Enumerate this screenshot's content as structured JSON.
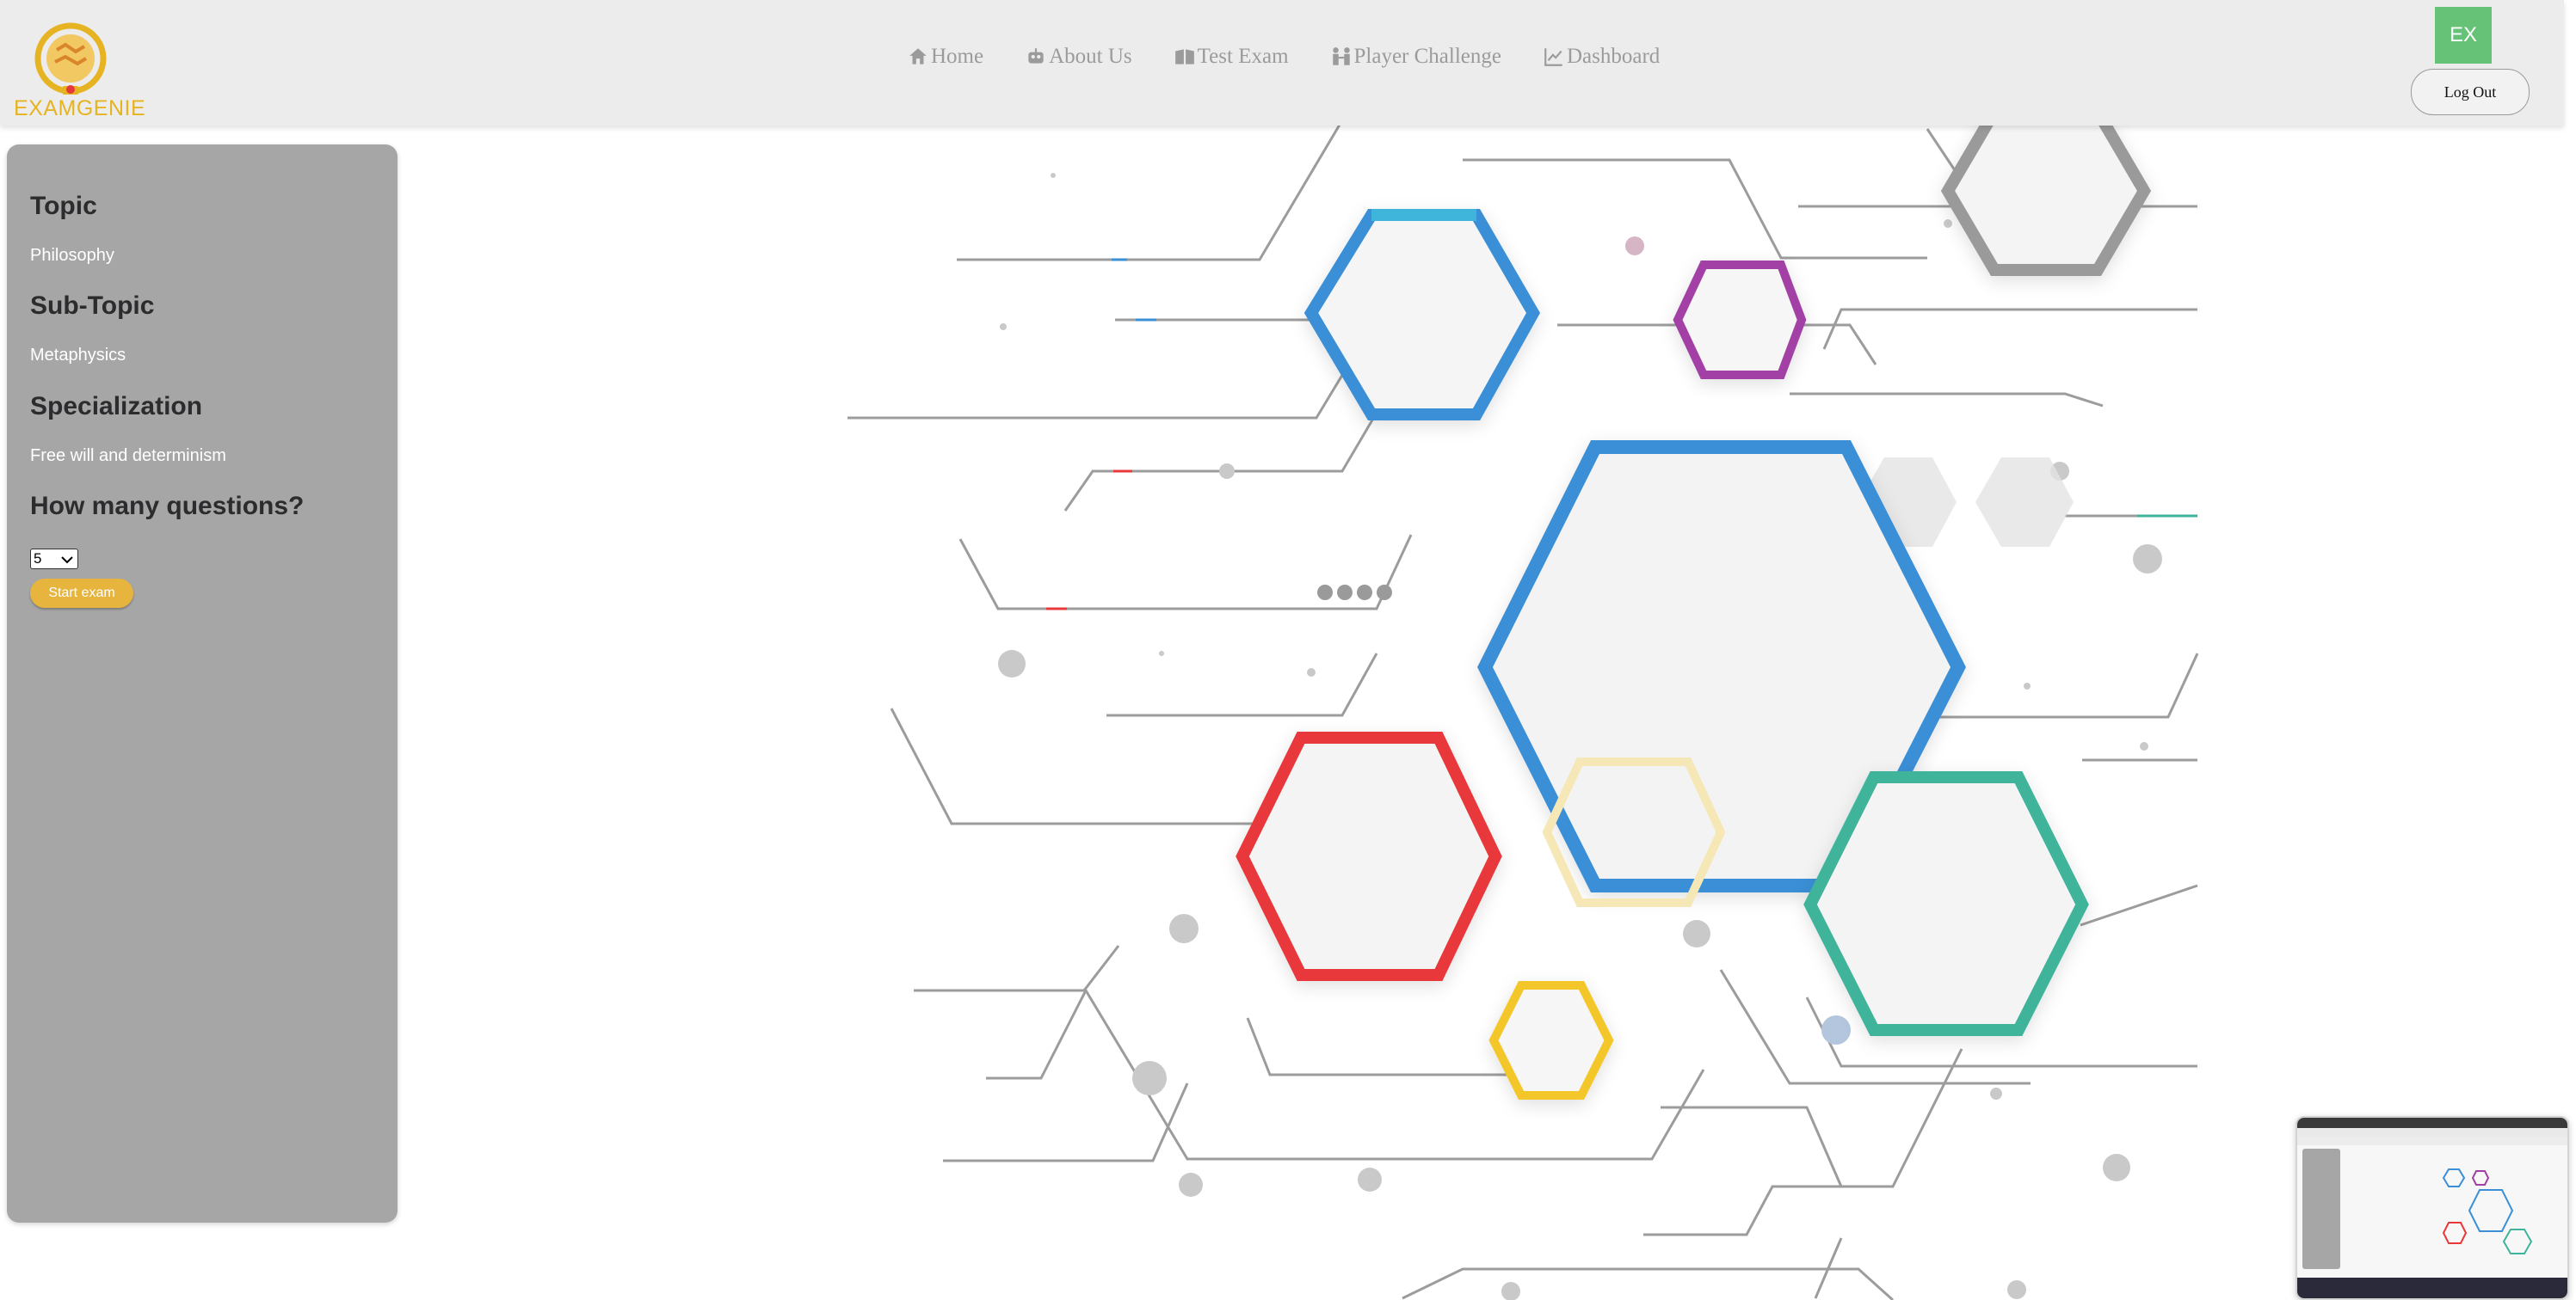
{
  "brand": {
    "name": "EXAMGENIE",
    "color": "#e6b422"
  },
  "nav": [
    {
      "label": "Home",
      "icon": "home-icon"
    },
    {
      "label": "About Us",
      "icon": "robot-icon"
    },
    {
      "label": "Test Exam",
      "icon": "book-icon"
    },
    {
      "label": "Player Challenge",
      "icon": "players-icon"
    },
    {
      "label": "Dashboard",
      "icon": "chart-icon"
    }
  ],
  "user": {
    "initials": "EX",
    "logout_label": "Log Out",
    "avatar_color": "#66c276"
  },
  "sidebar": {
    "topic_heading": "Topic",
    "topic_value": "Philosophy",
    "subtopic_heading": "Sub-Topic",
    "subtopic_value": "Metaphysics",
    "specialization_heading": "Specialization",
    "specialization_value": "Free will and determinism",
    "questions_heading": "How many questions?",
    "questions_value": "5",
    "start_label": "Start exam",
    "start_color": "#e7b43d"
  },
  "illustration": {
    "hex_colors": [
      "#3a8fd6",
      "#3fb5dc",
      "#a23fa6",
      "#e8383a",
      "#3fb39b",
      "#f3c72c",
      "#9a9a9a"
    ]
  }
}
